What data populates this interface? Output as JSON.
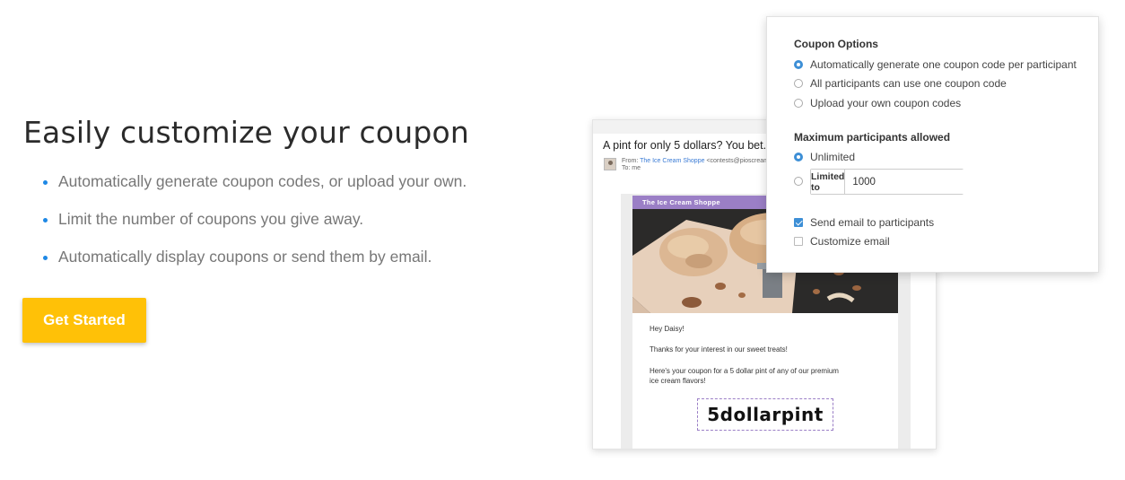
{
  "hero": {
    "headline": "Easily customize your coupon",
    "bullets": [
      "Automatically generate coupon codes, or upload your own.",
      "Limit the number of coupons you give away.",
      "Automatically display coupons or send them by email."
    ],
    "cta_label": "Get Started"
  },
  "email": {
    "subject": "A pint for only 5 dollars? You bet.",
    "from_label": "From:",
    "sender_name": "The Ice Cream Shoppe",
    "sender_email": "<contests@pioscream",
    "to_label": "To: me",
    "shop_name": "The Ice Cream Shoppe",
    "greeting": "Hey Daisy!",
    "line1": "Thanks for your interest in our sweet treats!",
    "line2a": "Here's your coupon for a 5 dollar pint of any of our premium",
    "line2b": "ice cream flavors!",
    "coupon_code": "5dollarpint"
  },
  "options": {
    "coupon_title": "Coupon Options",
    "coupon_choices": [
      {
        "label": "Automatically generate one coupon code per participant",
        "selected": true
      },
      {
        "label": "All participants can use one coupon code",
        "selected": false
      },
      {
        "label": "Upload your own coupon codes",
        "selected": false
      }
    ],
    "max_title": "Maximum participants allowed",
    "unlimited_label": "Unlimited",
    "limited_label": "Limited to",
    "limited_value": "1000",
    "send_email_label": "Send email to participants",
    "send_email_checked": true,
    "customize_email_label": "Customize email",
    "customize_email_checked": false
  },
  "colors": {
    "accent_blue": "#3d8fd6",
    "cta_yellow": "#ffc107",
    "shop_purple": "#9b7fc6"
  }
}
